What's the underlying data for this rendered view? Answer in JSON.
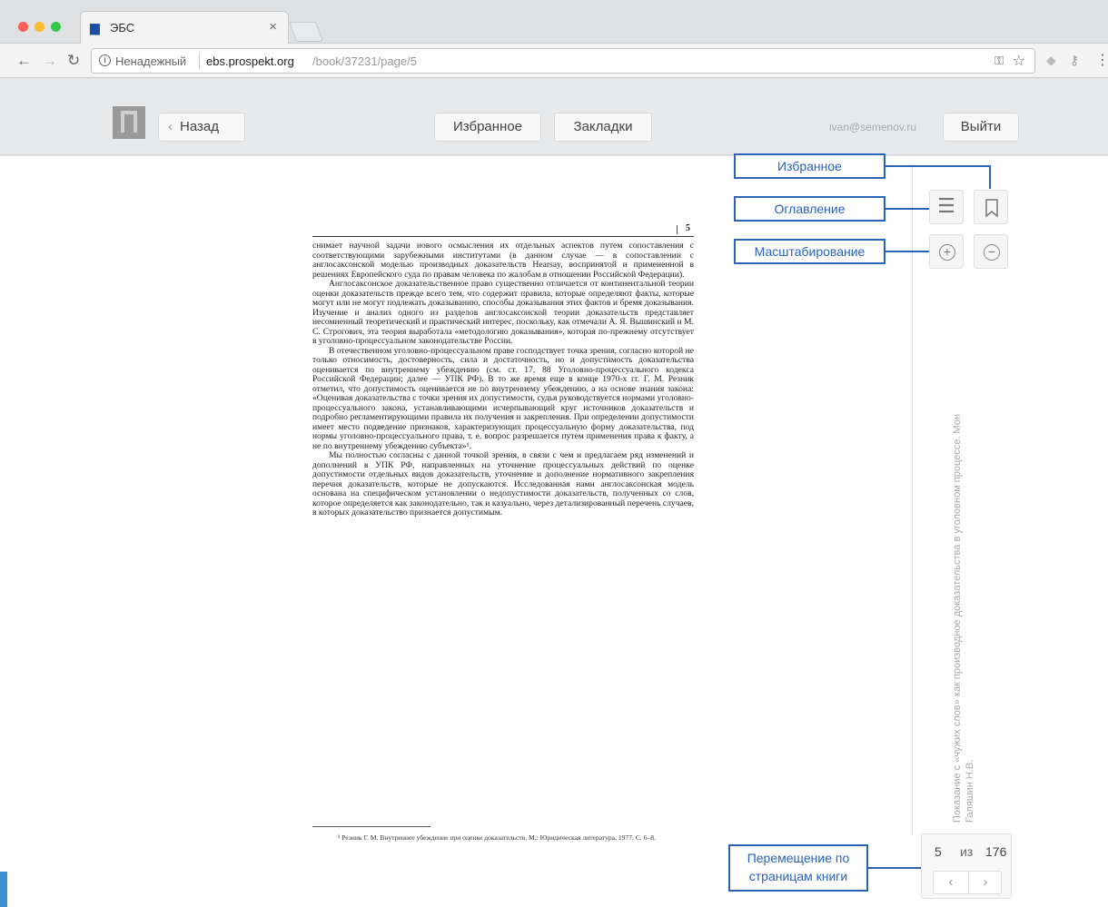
{
  "browser": {
    "tab_title": "ЭБС",
    "tab_close": "×",
    "insecure_label": "Ненадежный",
    "url_host": "ebs.prospekt.org",
    "url_path": "/book/37231/page/5"
  },
  "header": {
    "back_label": "Назад",
    "favorites_label": "Избранное",
    "bookmarks_label": "Закладки",
    "user_email": "ivan@semenov.ru",
    "logout_label": "Выйти"
  },
  "page": {
    "number": "5",
    "paragraphs": [
      "снимает научной задачи нового осмысления их отдельных аспектов путем сопоставления с соответствующими зарубежными институтами (в данном случае — в сопоставлении с англосаксонской моделью производных доказательств Hearsay, воспринятой и примененной в решениях Европейского суда по правам человека по жалобам в отношении Российской Федерации).",
      "Англосаксонское доказательственное право существенно отличается от континентальной теории оценки доказательств прежде всего тем, что содержит правила, которые определяют факты, которые могут или не могут подлежать доказыванию, способы доказывания этих фактов и бремя доказывания. Изучение и анализ одного из разделов англосаксонской теории доказательств представляет несомненный теоретический и практический интерес, поскольку, как отмечали А. Я. Вышинский и М. С. Строгович, эта теория выработала «методологию доказывания», которая по-прежнему отсутствует в уголовно-процессуальном законодательстве России.",
      "В отечественном уголовно-процессуальном праве господствует точка зрения, согласно которой не только относимость, достоверность, сила и достаточность, но и допустимость доказательства оценивается по внутреннему убеждению (см. ст. 17, 88 Уголовно-процессуального кодекса Российской Федерации; далее — УПК РФ). В то же время еще в конце 1970-х гг. Г. М. Резник отметил, что допустимость оценивается не по внутреннему убеждению, а на основе знания закона: «Оценивая доказательства с точки зрения их допустимости, судья руководствуется нормами уголовно-процессуального закона, устанавливающими исчерпывающий круг источников доказательств и подробно регламентирующими правила их получения и закрепления. При определении допустимости имеет место подведение признаков, характеризующих процессуальную форму доказательства, под нормы уголовно-процессуального права, т. е. вопрос разрешается путем применения права к факту, а не по внутреннему убеждению субъекта»¹.",
      "Мы полностью согласны с данной точкой зрения, в связи с чем и предлагаем ряд изменений и дополнений в УПК РФ, направленных на уточнение процессуальных действий по оценке допустимости отдельных видов доказательств, уточнение и дополнение нормативного закрепления перечня доказательств, которые не допускаются. Исследованная нами англосаксонская модель основана на специфическом установлении о недопустимости доказательств, полученных со слов, которое определяется как законодательно, так и казуально, через детализированный перечень случаев, в которых доказательство признается допустимым."
    ],
    "footnote": "¹ Резник Г. М. Внутреннее убеждение при оценке доказательств. М.: Юридическая литература, 1977. С. 6–8."
  },
  "sidebar": {
    "book_title": "Показание с «чужих слов» как производное доказательства в уголовном процессе. Мон",
    "book_author": "Галяшин Н.В."
  },
  "pager": {
    "current": "5",
    "of": "из",
    "total": "176",
    "prev": "‹",
    "next": "›"
  },
  "callouts": {
    "favorites": "Избранное",
    "toc": "Оглавление",
    "zoom": "Масштабирование",
    "pager": "Перемещение по страницам книги"
  },
  "icons": {
    "toc": "list-icon",
    "bookmark": "bookmark-icon",
    "zoom_in": "zoom-in-icon",
    "zoom_out": "zoom-out-icon"
  },
  "colors": {
    "callout": "#2b63b8",
    "accent_edge": "#3b8fd1"
  }
}
